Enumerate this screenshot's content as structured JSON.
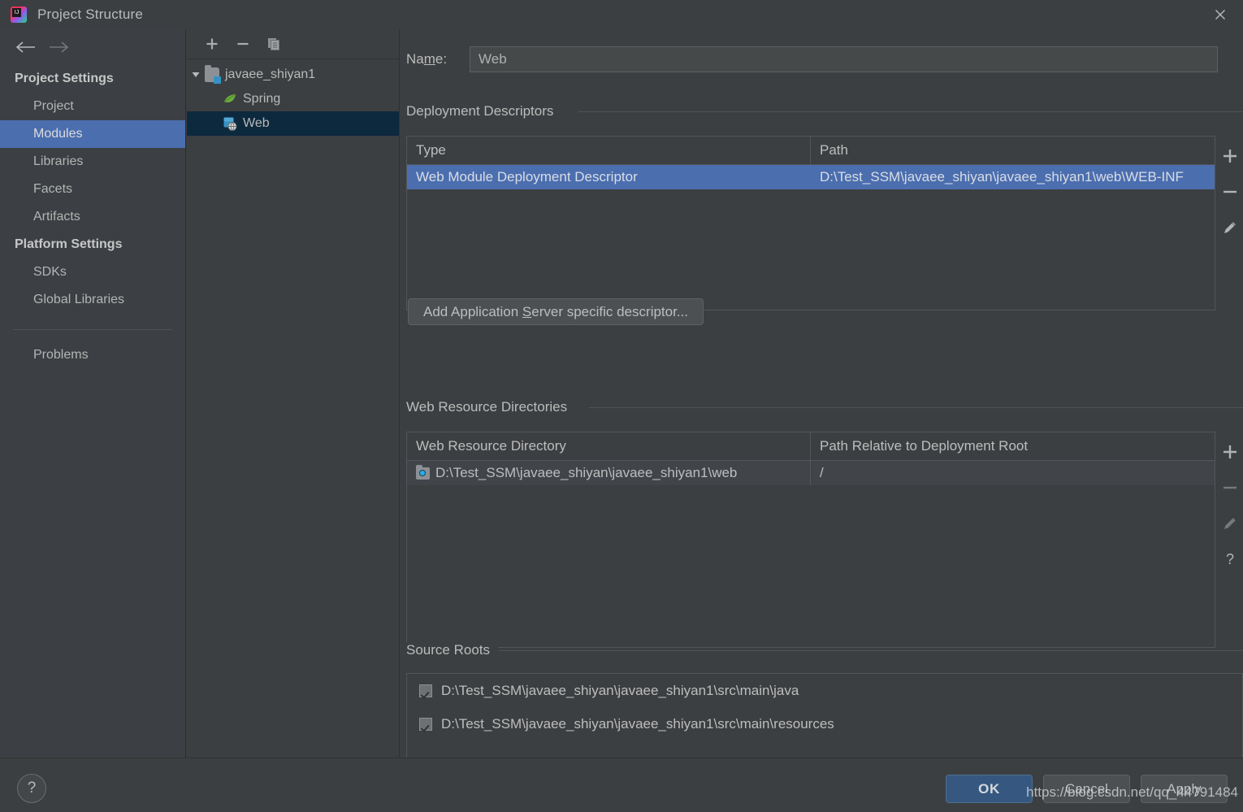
{
  "window": {
    "title": "Project Structure",
    "app_icon": "intellij-idea-logo-icon",
    "close_icon": "close-icon"
  },
  "nav": {
    "back_icon": "arrow-left-icon",
    "forward_icon": "arrow-right-icon"
  },
  "sidebar": {
    "groups": [
      {
        "title": "Project Settings",
        "items": [
          {
            "label": "Project",
            "selected": false
          },
          {
            "label": "Modules",
            "selected": true
          },
          {
            "label": "Libraries",
            "selected": false
          },
          {
            "label": "Facets",
            "selected": false
          },
          {
            "label": "Artifacts",
            "selected": false
          }
        ]
      },
      {
        "title": "Platform Settings",
        "items": [
          {
            "label": "SDKs",
            "selected": false
          },
          {
            "label": "Global Libraries",
            "selected": false
          }
        ]
      }
    ],
    "extra_items": [
      {
        "label": "Problems",
        "selected": false
      }
    ]
  },
  "module_tree": {
    "toolbar": [
      {
        "name": "add-module-button",
        "icon": "plus-icon"
      },
      {
        "name": "remove-module-button",
        "icon": "minus-icon"
      },
      {
        "name": "copy-module-button",
        "icon": "copy-icon"
      }
    ],
    "nodes": [
      {
        "label": "javaee_shiyan1",
        "icon": "folder-module-icon",
        "expanded": true,
        "depth": 0,
        "selected": false,
        "twisty": "chevron-down-icon"
      },
      {
        "label": "Spring",
        "icon": "spring-leaf-icon",
        "depth": 1,
        "selected": false
      },
      {
        "label": "Web",
        "icon": "web-globe-icon",
        "depth": 1,
        "selected": true
      }
    ]
  },
  "main": {
    "name_field": {
      "label_before": "Na",
      "label_mnemonic": "m",
      "label_after": "e:",
      "value": "Web",
      "placeholder": ""
    },
    "deployment_descriptors": {
      "title": "Deployment Descriptors",
      "columns": [
        "Type",
        "Path"
      ],
      "rows": [
        {
          "type": "Web Module Deployment Descriptor",
          "path": "D:\\Test_SSM\\javaee_shiyan\\javaee_shiyan1\\web\\WEB-INF",
          "selected": true
        }
      ],
      "actions": [
        {
          "name": "add-descriptor-button",
          "icon": "plus-icon",
          "enabled": true
        },
        {
          "name": "remove-descriptor-button",
          "icon": "minus-icon",
          "enabled": true
        },
        {
          "name": "edit-descriptor-button",
          "icon": "pencil-icon",
          "enabled": true
        }
      ],
      "add_button_label_before": "Add Application ",
      "add_button_mnemonic": "S",
      "add_button_label_after": "erver specific descriptor..."
    },
    "web_resource_directories": {
      "title": "Web Resource Directories",
      "columns": [
        "Web Resource Directory",
        "Path Relative to Deployment Root"
      ],
      "rows": [
        {
          "directory": "D:\\Test_SSM\\javaee_shiyan\\javaee_shiyan1\\web",
          "relative_path": "/",
          "icon": "folder-web-resource-icon"
        }
      ],
      "actions": [
        {
          "name": "add-web-resource-button",
          "icon": "plus-icon",
          "enabled": true
        },
        {
          "name": "remove-web-resource-button",
          "icon": "minus-icon",
          "enabled": false
        },
        {
          "name": "edit-web-resource-button",
          "icon": "pencil-icon",
          "enabled": false
        },
        {
          "name": "help-web-resource-button",
          "icon": "question-mark-icon",
          "enabled": true
        }
      ]
    },
    "source_roots": {
      "title": "Source Roots",
      "items": [
        {
          "path": "D:\\Test_SSM\\javaee_shiyan\\javaee_shiyan1\\src\\main\\java",
          "checked": true
        },
        {
          "path": "D:\\Test_SSM\\javaee_shiyan\\javaee_shiyan1\\src\\main\\resources",
          "checked": true
        }
      ]
    }
  },
  "footer": {
    "help_icon": "question-mark-icon",
    "ok_label": "OK",
    "cancel_label": "Cancel",
    "apply_label": "Apply",
    "watermark": "https://blog.csdn.net/qq_44791484"
  },
  "colors": {
    "window_bg": "#3c3f41",
    "sidebar_bg": "#3c4044",
    "selection_blue": "#4b6eaf",
    "tree_selection_blue": "#0d293e",
    "primary_button": "#365880",
    "text": "#bbbbbb",
    "border": "#515658",
    "badge_blue": "#3592c4",
    "spring_green": "#6cab3d"
  }
}
